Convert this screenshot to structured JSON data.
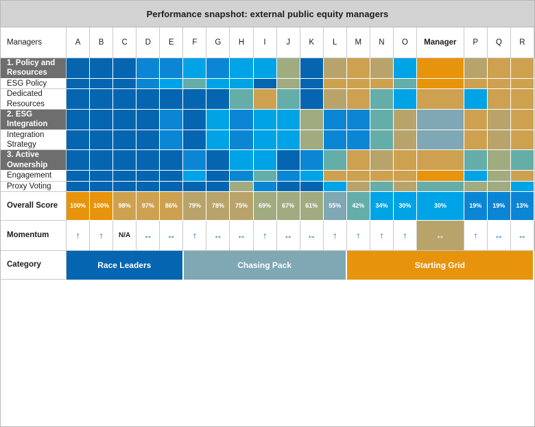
{
  "title": "Performance snapshot: external public equity managers",
  "palette": {
    "deep_blue": "#0565b0",
    "mid_blue": "#0b86d4",
    "bright_blue": "#00a3e6",
    "teal": "#64ada9",
    "steel": "#7fa7b4",
    "sage": "#a0ab80",
    "tan": "#b8a46a",
    "gold": "#cda14f",
    "orange": "#e8930c",
    "grey_header": "#d2d2d2",
    "grey_group": "#6e6e6e",
    "arrow_blue": "#1c6fba"
  },
  "header": {
    "corner_label": "Managers",
    "columns": [
      "A",
      "B",
      "C",
      "D",
      "E",
      "F",
      "G",
      "H",
      "I",
      "J",
      "K",
      "L",
      "M",
      "N",
      "O",
      "Manager",
      "P",
      "Q",
      "R"
    ],
    "wide_column_index": 15
  },
  "rows": [
    {
      "label": "1. Policy and Resources",
      "type": "group",
      "colors": [
        "deep_blue",
        "deep_blue",
        "deep_blue",
        "mid_blue",
        "mid_blue",
        "bright_blue",
        "mid_blue",
        "bright_blue",
        "bright_blue",
        "sage",
        "deep_blue",
        "tan",
        "gold",
        "tan",
        "bright_blue",
        "orange",
        "tan",
        "gold",
        "gold"
      ]
    },
    {
      "label": "ESG Policy",
      "type": "sub",
      "colors": [
        "deep_blue",
        "deep_blue",
        "deep_blue",
        "mid_blue",
        "bright_blue",
        "teal",
        "bright_blue",
        "bright_blue",
        "deep_blue",
        "sage",
        "deep_blue",
        "gold",
        "gold",
        "gold",
        "teal",
        "orange",
        "gold",
        "gold",
        "gold"
      ]
    },
    {
      "label": "Dedicated Resources",
      "type": "sub",
      "colors": [
        "deep_blue",
        "deep_blue",
        "deep_blue",
        "deep_blue",
        "deep_blue",
        "deep_blue",
        "deep_blue",
        "teal",
        "gold",
        "teal",
        "deep_blue",
        "tan",
        "gold",
        "teal",
        "bright_blue",
        "gold",
        "bright_blue",
        "gold",
        "gold"
      ]
    },
    {
      "label": "2. ESG Integration",
      "type": "group",
      "colors": [
        "deep_blue",
        "deep_blue",
        "deep_blue",
        "deep_blue",
        "mid_blue",
        "deep_blue",
        "bright_blue",
        "mid_blue",
        "bright_blue",
        "bright_blue",
        "sage",
        "mid_blue",
        "mid_blue",
        "teal",
        "tan",
        "steel",
        "gold",
        "tan",
        "gold"
      ]
    },
    {
      "label": "Integration Strategy",
      "type": "sub",
      "colors": [
        "deep_blue",
        "deep_blue",
        "deep_blue",
        "deep_blue",
        "mid_blue",
        "deep_blue",
        "bright_blue",
        "mid_blue",
        "bright_blue",
        "bright_blue",
        "sage",
        "mid_blue",
        "mid_blue",
        "teal",
        "tan",
        "steel",
        "gold",
        "tan",
        "gold"
      ]
    },
    {
      "label": "3. Active Ownership",
      "type": "group",
      "colors": [
        "deep_blue",
        "deep_blue",
        "deep_blue",
        "deep_blue",
        "deep_blue",
        "mid_blue",
        "deep_blue",
        "bright_blue",
        "bright_blue",
        "deep_blue",
        "mid_blue",
        "teal",
        "gold",
        "tan",
        "gold",
        "gold",
        "teal",
        "sage",
        "teal"
      ]
    },
    {
      "label": "Engagement",
      "type": "sub",
      "colors": [
        "deep_blue",
        "deep_blue",
        "deep_blue",
        "deep_blue",
        "deep_blue",
        "bright_blue",
        "deep_blue",
        "mid_blue",
        "teal",
        "mid_blue",
        "bright_blue",
        "gold",
        "gold",
        "gold",
        "gold",
        "orange",
        "bright_blue",
        "sage",
        "gold"
      ]
    },
    {
      "label": "Proxy Voting",
      "type": "sub",
      "colors": [
        "deep_blue",
        "deep_blue",
        "deep_blue",
        "deep_blue",
        "deep_blue",
        "deep_blue",
        "deep_blue",
        "sage",
        "mid_blue",
        "deep_blue",
        "deep_blue",
        "bright_blue",
        "tan",
        "teal",
        "tan",
        "teal",
        "sage",
        "sage",
        "bright_blue"
      ]
    }
  ],
  "overall_score": {
    "label": "Overall Score",
    "values": [
      "100%",
      "100%",
      "98%",
      "97%",
      "86%",
      "79%",
      "78%",
      "75%",
      "69%",
      "67%",
      "61%",
      "55%",
      "42%",
      "34%",
      "30%",
      "30%",
      "19%",
      "19%",
      "13%"
    ],
    "colors": [
      "orange",
      "orange",
      "gold",
      "gold",
      "gold",
      "tan",
      "tan",
      "tan",
      "sage",
      "sage",
      "sage",
      "steel",
      "teal",
      "bright_blue",
      "bright_blue",
      "bright_blue",
      "mid_blue",
      "mid_blue",
      "mid_blue"
    ]
  },
  "momentum": {
    "label": "Momentum",
    "values": [
      "↑",
      "↑",
      "N/A",
      "↔",
      "↔",
      "↑",
      "↔",
      "↔",
      "↑",
      "↔",
      "↔",
      "↑",
      "↑",
      "↑",
      "↑",
      "↔",
      "↑",
      "↔",
      "↔"
    ],
    "tinted_index": 15,
    "tinted_color": "tan"
  },
  "category": {
    "label": "Category",
    "bands": [
      {
        "label": "Race Leaders",
        "span": 5,
        "color": "#0565b0"
      },
      {
        "label": "Chasing Pack",
        "span": 7,
        "color": "#7fa7b4"
      },
      {
        "label": "Starting Grid",
        "span": 7,
        "color": "#e8930c"
      }
    ]
  }
}
